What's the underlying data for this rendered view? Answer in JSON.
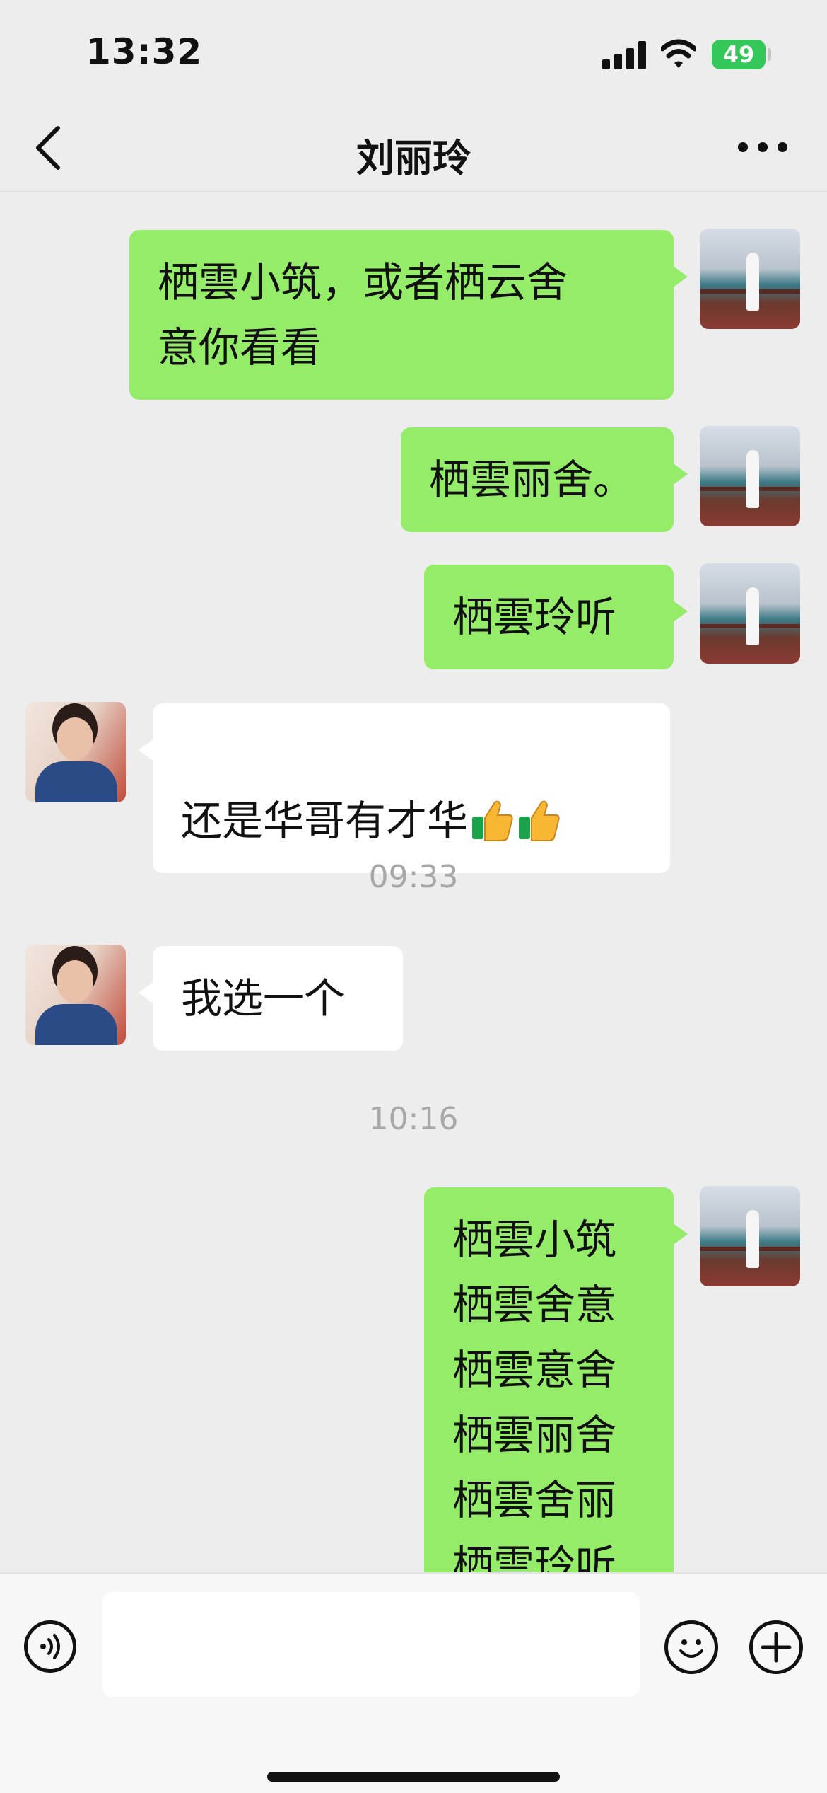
{
  "status_bar": {
    "time": "13:32",
    "battery": "49"
  },
  "nav": {
    "title": "刘丽玲"
  },
  "messages": [
    {
      "sender": "self",
      "text": "栖雲小筑，或者栖云舍\n意你看看"
    },
    {
      "sender": "self",
      "text": "栖雲丽舍。"
    },
    {
      "sender": "self",
      "text": "栖雲玲听"
    },
    {
      "sender": "other",
      "text": "还是华哥有才华",
      "emoji": "thumbs-up x2"
    },
    {
      "type": "time",
      "text": "09:33"
    },
    {
      "sender": "other",
      "text": "我选一个"
    },
    {
      "type": "time",
      "text": "10:16"
    },
    {
      "sender": "self",
      "text": "栖雲小筑\n栖雲舍意\n栖雲意舍\n栖雲丽舍\n栖雲舍丽\n栖雲玲听"
    }
  ],
  "input": {
    "value": "",
    "placeholder": ""
  },
  "colors": {
    "background": "#ededed",
    "self_bubble": "#95ec69",
    "other_bubble": "#ffffff",
    "battery": "#34c759"
  },
  "icons": {
    "back": "chevron-left-icon",
    "more": "more-icon",
    "voice": "voice-icon",
    "emoji": "emoji-icon",
    "plus": "plus-icon"
  }
}
